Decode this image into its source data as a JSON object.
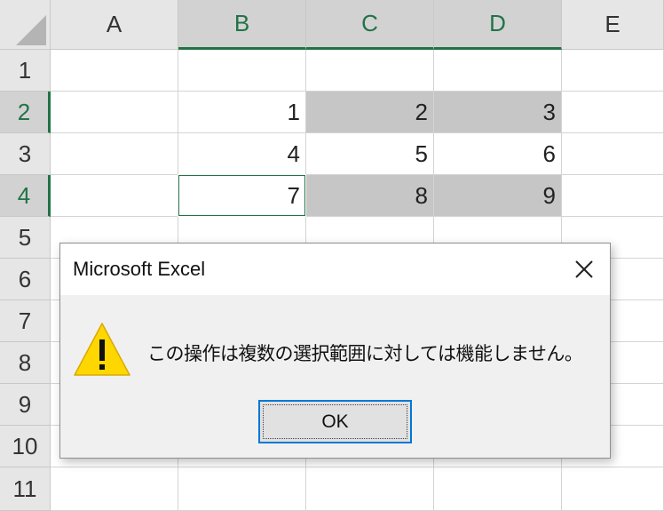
{
  "columns": [
    "A",
    "B",
    "C",
    "D",
    "E"
  ],
  "rows": [
    "1",
    "2",
    "3",
    "4",
    "5",
    "6",
    "7",
    "8",
    "9",
    "10",
    "11"
  ],
  "cells": {
    "B2": "1",
    "C2": "2",
    "D2": "3",
    "B3": "4",
    "C3": "5",
    "D3": "6",
    "B4": "7",
    "C4": "8",
    "D4": "9"
  },
  "dialog": {
    "title": "Microsoft Excel",
    "message": "この操作は複数の選択範囲に対しては機能しません。",
    "ok_label": "OK"
  },
  "colors": {
    "excel_green": "#217346",
    "selection_gray": "#c6c6c6",
    "warning_yellow": "#ffd700"
  }
}
